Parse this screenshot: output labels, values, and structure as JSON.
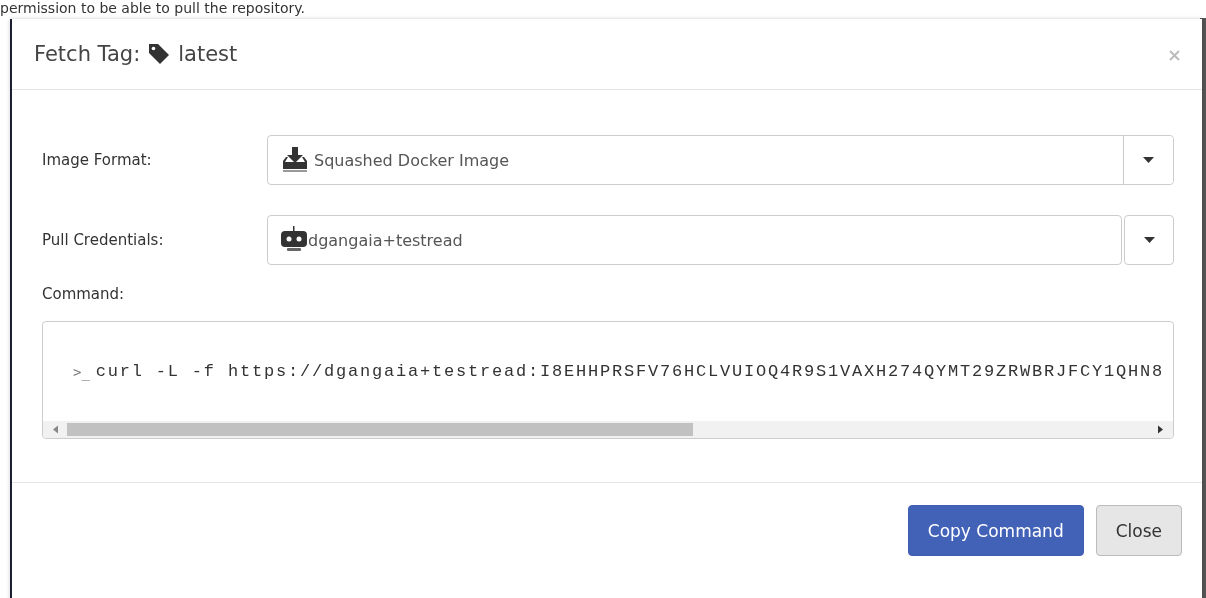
{
  "background_text": "permission to be able to pull the repository.",
  "dialog": {
    "title": "Fetch Tag:",
    "tag": "latest"
  },
  "fields": [
    {
      "label": "Image Format:",
      "value": "Squashed Docker Image",
      "kind": "format"
    },
    {
      "label": "Pull Credentials:",
      "value": "dgangaia+testread",
      "kind": "robot"
    }
  ],
  "command": {
    "label": "Command:",
    "prompt": ">_",
    "text": "curl -L -f https://dgangaia+testread:I8EHHPRSFV76HCLVUIOQ4R9S1VAXH274QYMT29ZRWBRJFCY1QHN8"
  },
  "buttons": [
    {
      "label": "Copy Command",
      "kind": "primary"
    },
    {
      "label": "Close",
      "kind": "default"
    }
  ]
}
